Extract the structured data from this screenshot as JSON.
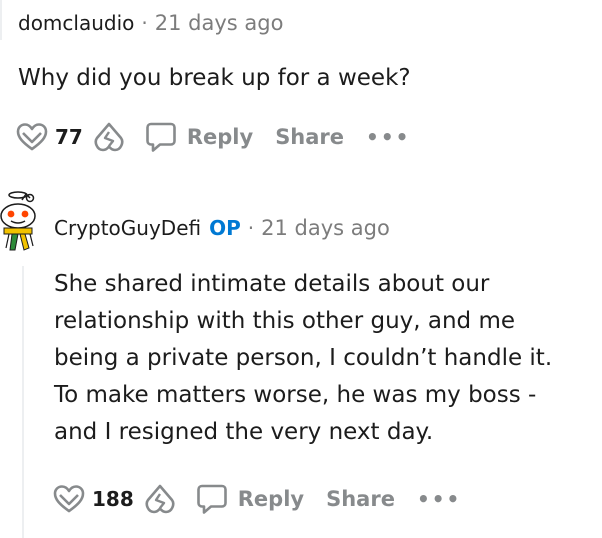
{
  "comments": [
    {
      "author": "domclaudio",
      "timestamp": "21 days ago",
      "body": "Why did you break up for a week?",
      "votes": "77",
      "reply_label": "Reply",
      "share_label": "Share",
      "more_label": "•••"
    },
    {
      "author": "CryptoGuyDefi",
      "op_badge": "OP",
      "timestamp": "21 days ago",
      "body_lines": [
        "She shared intimate details about our",
        "relationship with this other guy, and me",
        "being a private person, I couldn’t handle it.",
        "To make matters worse, he was my boss -",
        "and I resigned the very next day."
      ],
      "votes": "188",
      "reply_label": "Reply",
      "share_label": "Share",
      "more_label": "•••"
    }
  ],
  "separator": "·",
  "icons": {
    "upvote": "heart-upvote-icon",
    "downvote": "broken-heart-downvote-icon",
    "reply": "speech-bubble-icon",
    "more": "ellipsis-icon",
    "avatar": "snoo-avatar-icon"
  },
  "colors": {
    "op_badge": "#0079d3",
    "muted": "#878a8c",
    "text": "#1c1c1c"
  }
}
